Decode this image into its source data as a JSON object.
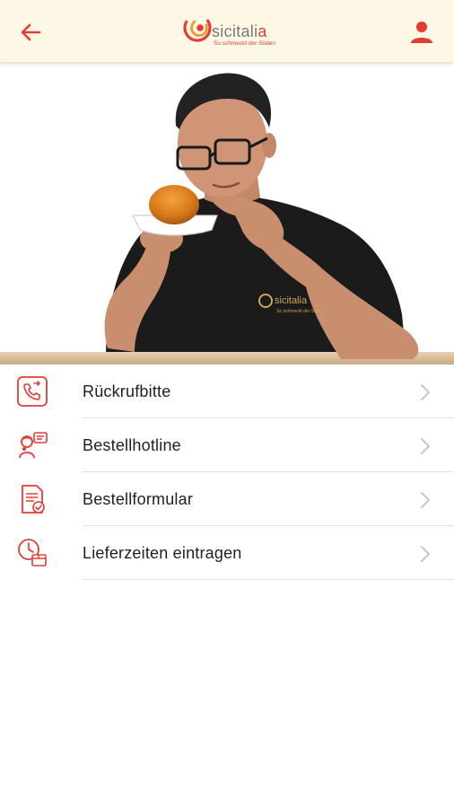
{
  "header": {
    "back_icon": "arrow-left-icon",
    "profile_icon": "person-icon",
    "logo": {
      "word_main": "sicitali",
      "word_accent": "a",
      "tagline": "So schmeckt der Süden"
    },
    "colors": {
      "accent": "#e33d33",
      "bar_background": "#fdf7e6"
    }
  },
  "hero": {
    "shirt_logo_word": "sicitalia",
    "shirt_logo_tagline": "So schmeckt der Süden"
  },
  "menu": {
    "items": [
      {
        "label": "Rückrufbitte",
        "icon": "phone-callback-icon"
      },
      {
        "label": "Bestellhotline",
        "icon": "hotline-agent-icon"
      },
      {
        "label": "Bestellformular",
        "icon": "order-form-icon"
      },
      {
        "label": "Lieferzeiten eintragen",
        "icon": "delivery-time-icon"
      }
    ]
  }
}
